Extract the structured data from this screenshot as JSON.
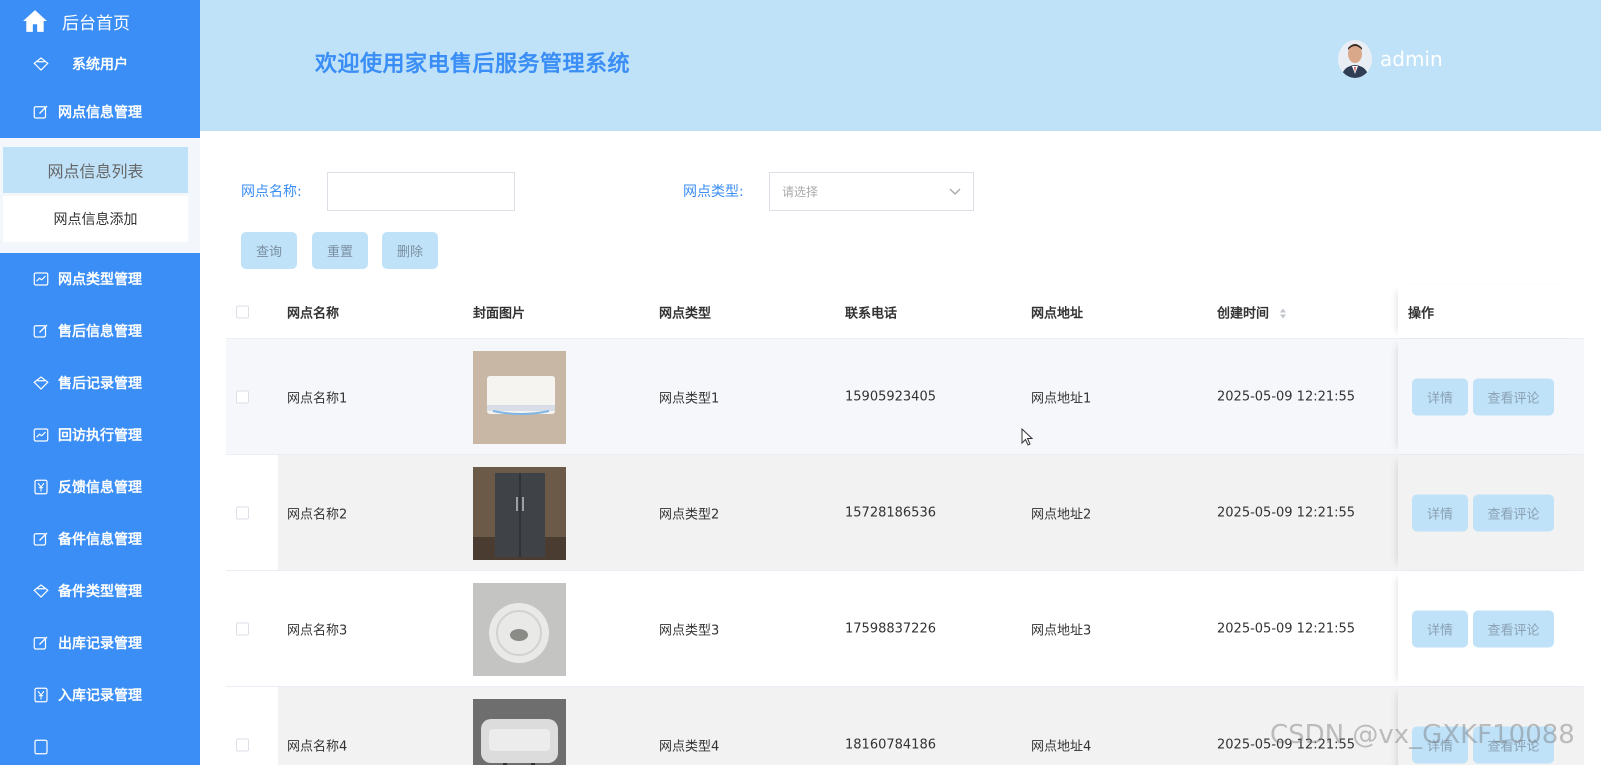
{
  "sidebar": {
    "home_label": "后台首页",
    "items": [
      {
        "label": "系统用户",
        "icon": "diamond-icon"
      },
      {
        "label": "网点信息管理",
        "icon": "edit-icon"
      },
      {
        "label": "网点类型管理",
        "icon": "chart-icon"
      },
      {
        "label": "售后信息管理",
        "icon": "edit-icon"
      },
      {
        "label": "售后记录管理",
        "icon": "diamond-icon"
      },
      {
        "label": "回访执行管理",
        "icon": "chart-icon"
      },
      {
        "label": "反馈信息管理",
        "icon": "yen-icon"
      },
      {
        "label": "备件信息管理",
        "icon": "edit-icon"
      },
      {
        "label": "备件类型管理",
        "icon": "diamond-icon"
      },
      {
        "label": "出库记录管理",
        "icon": "edit-icon"
      },
      {
        "label": "入库记录管理",
        "icon": "yen-icon"
      }
    ],
    "submenu": [
      "网点信息列表",
      "网点信息添加"
    ]
  },
  "header": {
    "title": "欢迎使用家电售后服务管理系统",
    "username": "admin"
  },
  "search": {
    "name_label": "网点名称:",
    "name_value": "",
    "type_label": "网点类型:",
    "type_placeholder": "请选择",
    "query_button": "查询",
    "reset_button": "重置",
    "delete_button": "删除"
  },
  "table": {
    "columns": [
      "网点名称",
      "封面图片",
      "网点类型",
      "联系电话",
      "网点地址",
      "创建时间",
      "操作"
    ],
    "rows": [
      {
        "name": "网点名称1",
        "type": "网点类型1",
        "phone": "15905923405",
        "address": "网点地址1",
        "created": "2025-05-09 12:21:55",
        "image": "air-conditioner"
      },
      {
        "name": "网点名称2",
        "type": "网点类型2",
        "phone": "15728186536",
        "address": "网点地址2",
        "created": "2025-05-09 12:21:55",
        "image": "refrigerator"
      },
      {
        "name": "网点名称3",
        "type": "网点类型3",
        "phone": "17598837226",
        "address": "网点地址3",
        "created": "2025-05-09 12:21:55",
        "image": "ceiling-fan"
      },
      {
        "name": "网点名称4",
        "type": "网点类型4",
        "phone": "18160784186",
        "address": "网点地址4",
        "created": "2025-05-09 12:21:55",
        "image": "water-heater"
      }
    ],
    "detail_button": "详情",
    "review_button": "查看评论"
  },
  "watermark": "CSDN @vx_GXKF10088",
  "colors": {
    "accent": "#3a8ef6",
    "header_bg": "#bfe2f9",
    "button_bg": "#bfe2f9"
  }
}
